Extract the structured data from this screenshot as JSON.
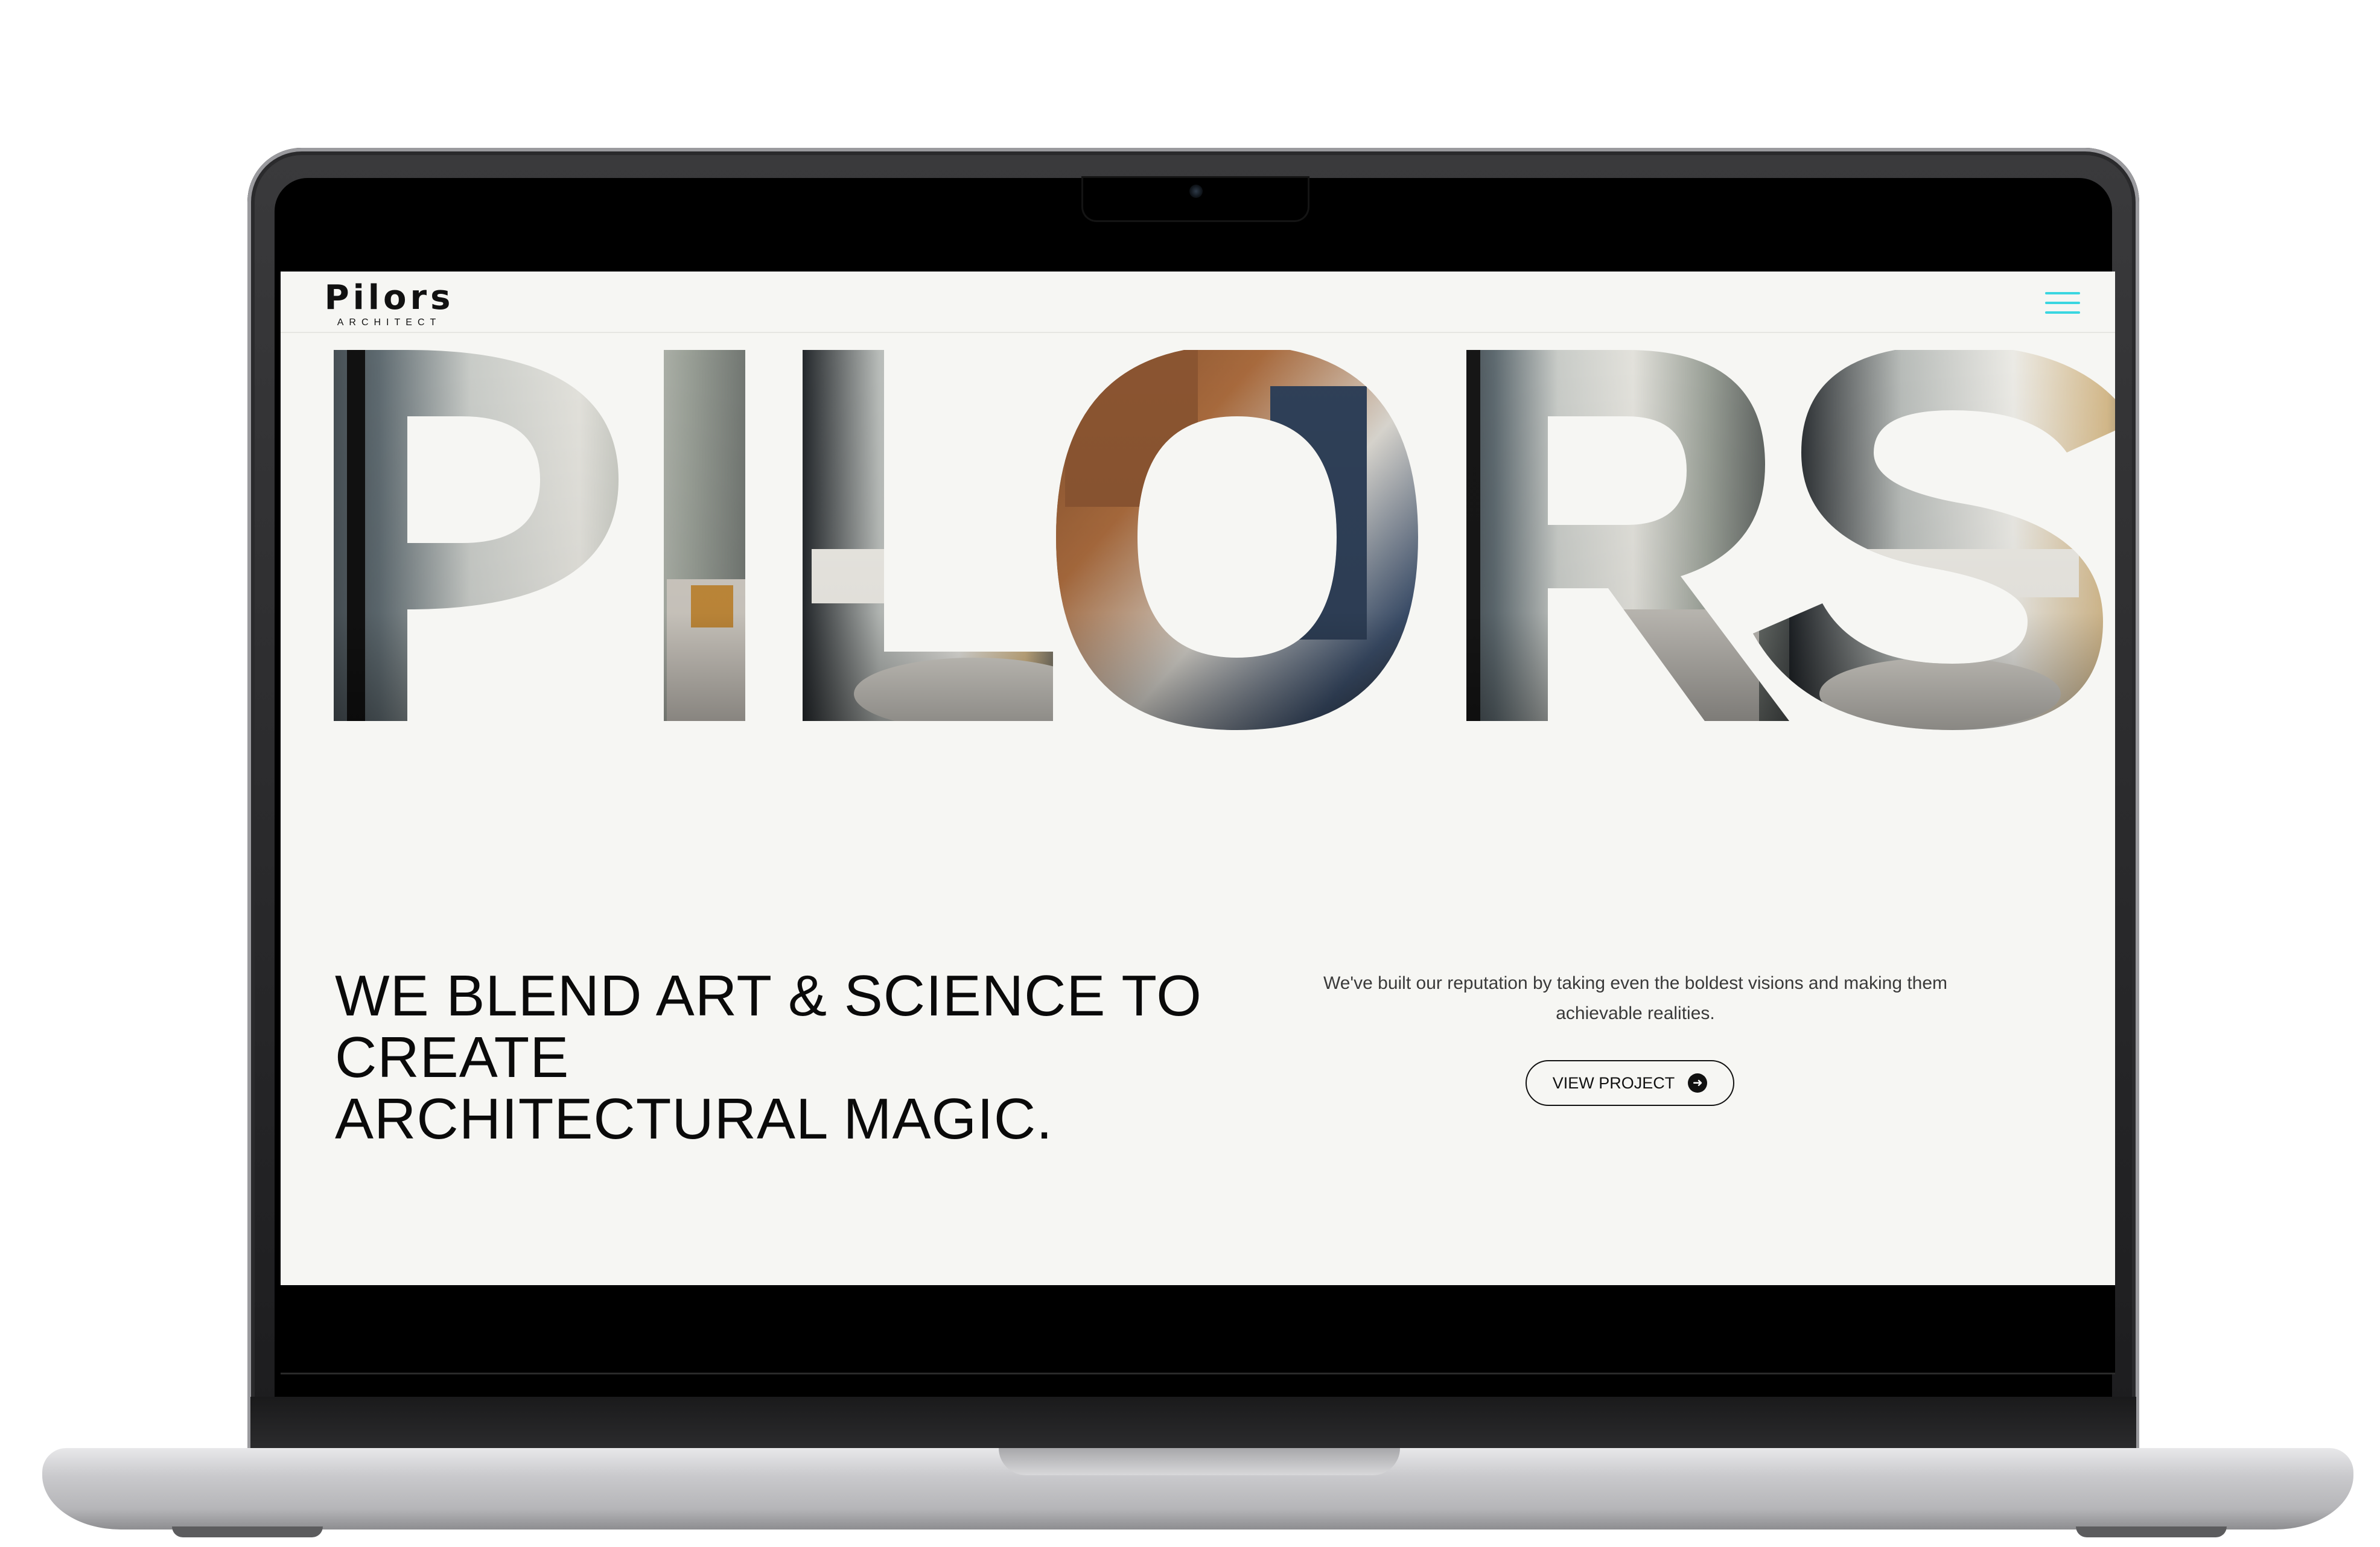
{
  "site": {
    "logo": {
      "wordmark": "Pilors",
      "subtitle": "ARCHITECT"
    },
    "menu_icon": "hamburger-menu-icon",
    "accent_color": "#3ad6e0"
  },
  "hero": {
    "letters": [
      "P",
      "I",
      "L",
      "O",
      "R",
      "S"
    ]
  },
  "intro": {
    "headline_lines": [
      "WE BLEND ART & SCIENCE TO",
      "CREATE",
      "ARCHITECTURAL MAGIC."
    ],
    "tagline": "We've built our reputation by taking even the boldest visions and making them achievable realities.",
    "cta_label": "VIEW PROJECT",
    "cta_icon": "arrow-right-circle-icon"
  },
  "colors": {
    "page_background": "#f6f6f3",
    "text": "#0a0a0a"
  }
}
